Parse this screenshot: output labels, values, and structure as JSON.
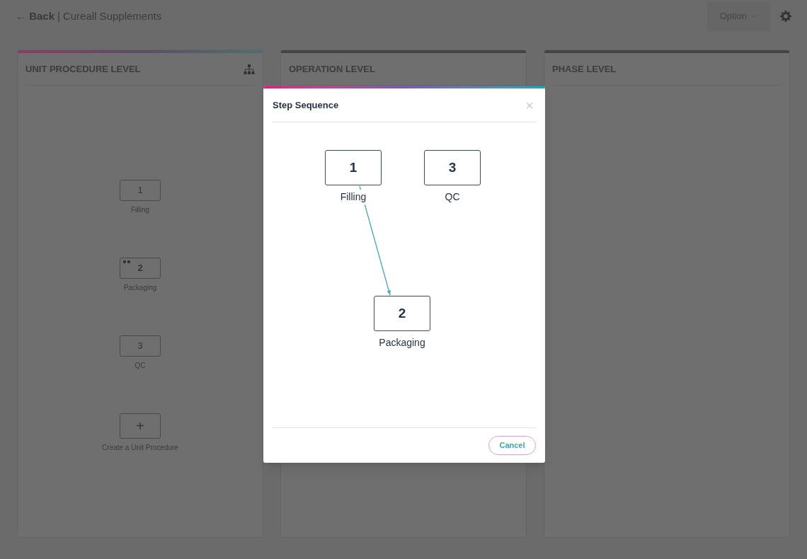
{
  "header": {
    "back": "← Back",
    "separator": "|",
    "title": "Cureall Supplements",
    "option": "Option"
  },
  "panels": [
    {
      "title": "UNIT PROCEDURE LEVEL",
      "active": true
    },
    {
      "title": "OPERATION LEVEL",
      "active": false
    },
    {
      "title": "PHASE LEVEL",
      "active": false
    }
  ],
  "unit_procedures": [
    {
      "number": "1",
      "label": "Filling",
      "selected": false
    },
    {
      "number": "2",
      "label": "Packaging",
      "selected": true
    },
    {
      "number": "3",
      "label": "QC",
      "selected": false
    }
  ],
  "create": {
    "symbol": "+",
    "label": "Create a Unit Procedure"
  },
  "dialog": {
    "title": "Step Sequence",
    "close": "×",
    "cancel": "Cancel",
    "nodes": [
      {
        "number": "1",
        "label": "Filling"
      },
      {
        "number": "3",
        "label": "QC"
      },
      {
        "number": "2",
        "label": "Packaging"
      }
    ]
  }
}
